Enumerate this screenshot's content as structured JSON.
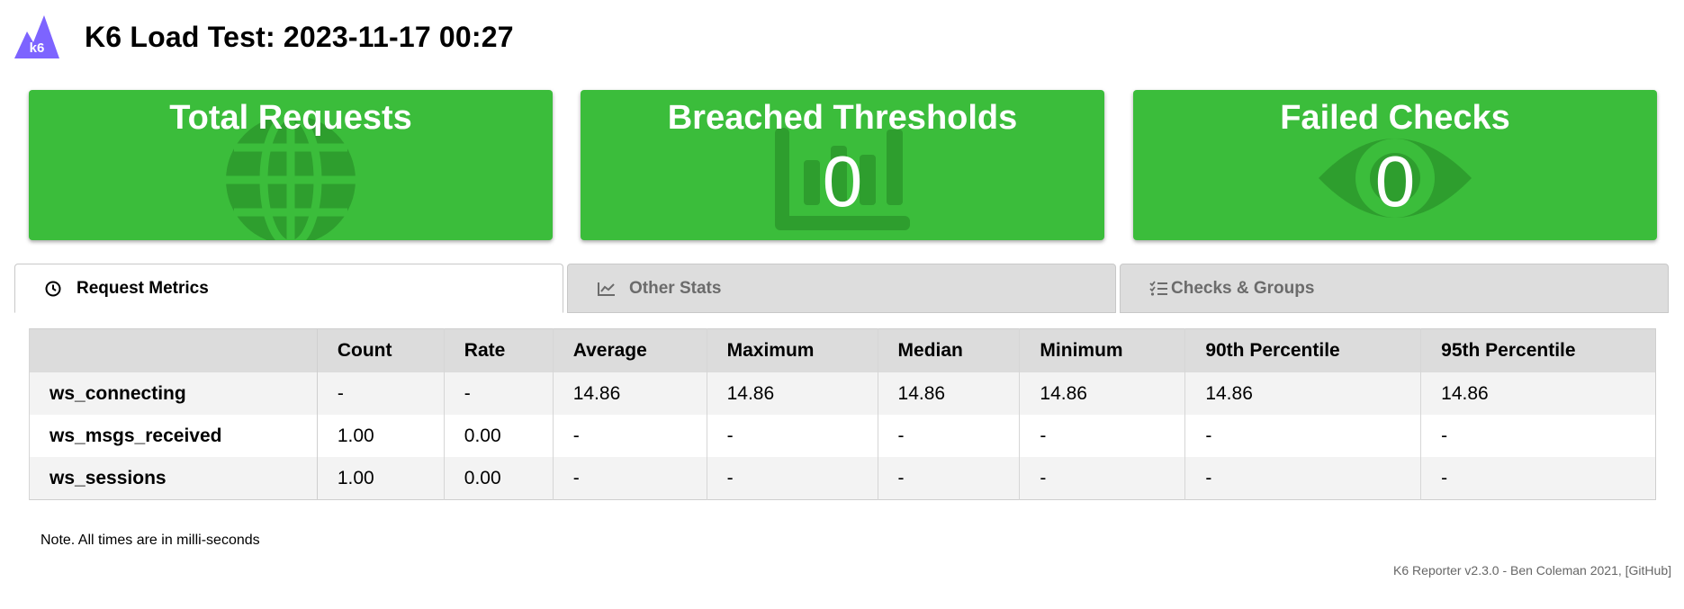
{
  "header": {
    "logo_text": "k6",
    "title": "K6 Load Test: 2023-11-17 00:27"
  },
  "stats": [
    {
      "title": "Total Requests",
      "value": "",
      "icon": "globe-icon"
    },
    {
      "title": "Breached Thresholds",
      "value": "0",
      "icon": "bar-chart-icon"
    },
    {
      "title": "Failed Checks",
      "value": "0",
      "icon": "eye-icon"
    }
  ],
  "tabs": [
    {
      "label": "Request Metrics",
      "icon": "clock-icon",
      "active": true
    },
    {
      "label": "Other Stats",
      "icon": "line-chart-icon",
      "active": false
    },
    {
      "label": "Checks & Groups",
      "icon": "checklist-icon",
      "active": false
    }
  ],
  "table": {
    "headers": [
      "",
      "Count",
      "Rate",
      "Average",
      "Maximum",
      "Median",
      "Minimum",
      "90th Percentile",
      "95th Percentile"
    ],
    "rows": [
      [
        "ws_connecting",
        "-",
        "-",
        "14.86",
        "14.86",
        "14.86",
        "14.86",
        "14.86",
        "14.86"
      ],
      [
        "ws_msgs_received",
        "1.00",
        "0.00",
        "-",
        "-",
        "-",
        "-",
        "-",
        "-"
      ],
      [
        "ws_sessions",
        "1.00",
        "0.00",
        "-",
        "-",
        "-",
        "-",
        "-",
        "-"
      ]
    ]
  },
  "note": "Note. All times are in milli-seconds",
  "footer": "K6 Reporter v2.3.0 - Ben Coleman 2021, [GitHub]",
  "colors": {
    "card_green": "#3bbd3b",
    "icon_green": "#2e9e2e",
    "logo_purple": "#7d64ff"
  }
}
